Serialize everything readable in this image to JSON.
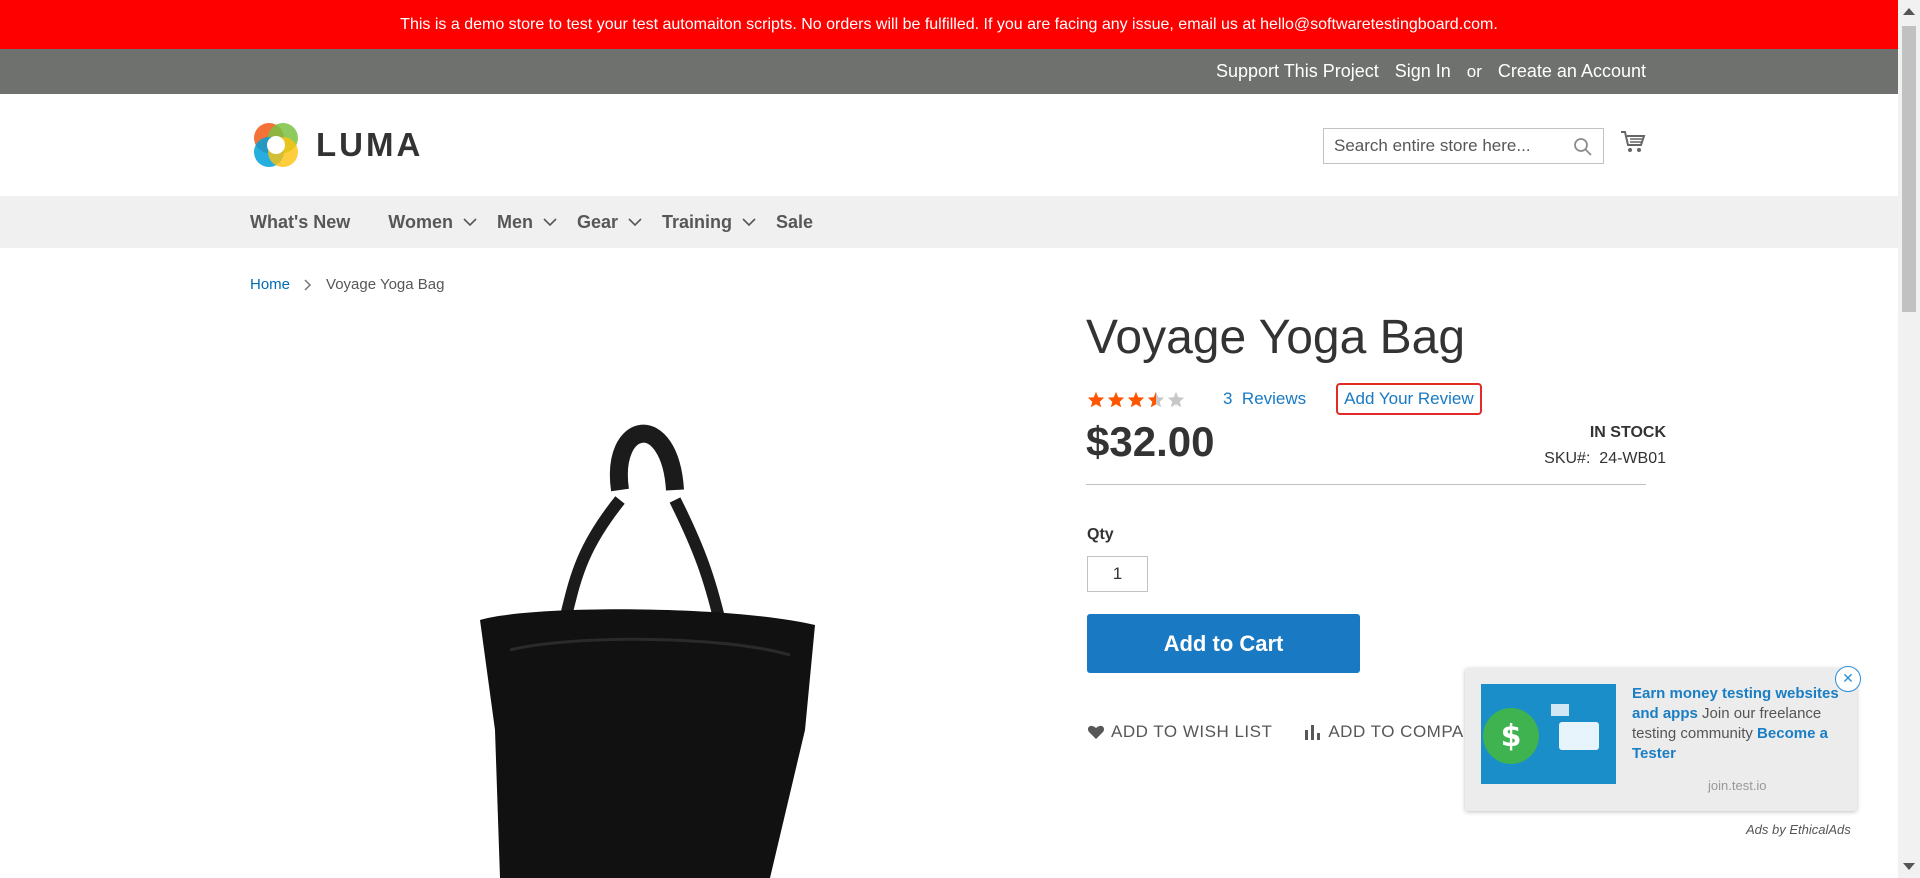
{
  "banner": {
    "text": "This is a demo store to test your test automaiton scripts. No orders will be fulfilled. If you are facing any issue, email us at hello@softwaretestingboard.com."
  },
  "top_links": {
    "support": "Support This Project",
    "sign_in": "Sign In",
    "or": "or",
    "create_account": "Create an Account"
  },
  "header": {
    "logo_text": "LUMA",
    "search_placeholder": "Search entire store here..."
  },
  "nav": {
    "items": [
      "What's New",
      "Women",
      "Men",
      "Gear",
      "Training",
      "Sale"
    ]
  },
  "breadcrumb": {
    "home": "Home",
    "current": "Voyage Yoga Bag"
  },
  "product": {
    "title": "Voyage Yoga Bag",
    "rating_percent": 60,
    "reviews_count": "3",
    "reviews_label": "Reviews",
    "add_review": "Add Your Review",
    "price": "$32.00",
    "stock": "IN STOCK",
    "sku_label": "SKU#:",
    "sku": "24-WB01",
    "qty_label": "Qty",
    "qty_value": "1",
    "add_to_cart": "Add to Cart",
    "wishlist": "Add to Wish List",
    "compare": "Add to Compare"
  },
  "ad": {
    "headline": "Earn money testing websites and apps",
    "body": " Join our freelance testing community ",
    "cta": "Become a Tester",
    "domain": "join.test.io",
    "footer": "Ads by EthicalAds"
  },
  "colors": {
    "banner": "#ff0000",
    "top_bar": "#6e716e",
    "link": "#1979c3",
    "star": "#ff5501"
  }
}
